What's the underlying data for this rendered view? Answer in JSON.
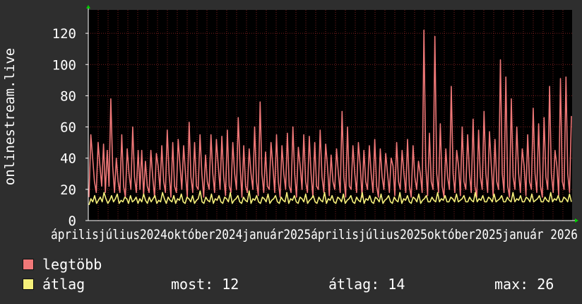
{
  "colors": {
    "background": "#2e2e2e",
    "plot_background": "#000000",
    "grid": "#7a1f1f",
    "axis": "#ffffff",
    "series_max": "#f07878",
    "series_avg": "#f5f07a",
    "arrow": "#00cc00"
  },
  "chart_data": {
    "type": "line",
    "ylabel": "onlinestream.live",
    "ylim": [
      0,
      135
    ],
    "y_ticks": [
      0,
      20,
      40,
      60,
      80,
      100,
      120
    ],
    "x_tick_labels": [
      "április",
      "július",
      "2024",
      "október",
      "2024",
      "január",
      "2025",
      "április",
      "2025",
      "július",
      "2025",
      "október",
      "2025",
      "január",
      "2026"
    ],
    "x_axis_text": "áprilisjúlius2024október2024január2025áprilisjúlius2025október2025január 2026",
    "grid": true,
    "series": [
      {
        "name": "legtöbb",
        "color": "#f07878",
        "values": [
          15,
          55,
          40,
          25,
          18,
          50,
          35,
          22,
          49,
          18,
          45,
          22,
          78,
          35,
          18,
          40,
          25,
          18,
          55,
          22,
          15,
          46,
          30,
          20,
          60,
          28,
          18,
          45,
          20,
          45,
          16,
          38,
          22,
          18,
          45,
          28,
          15,
          43,
          35,
          20,
          48,
          25,
          18,
          58,
          30,
          15,
          50,
          22,
          18,
          52,
          35,
          20,
          48,
          30,
          15,
          63,
          28,
          18,
          50,
          22,
          20,
          55,
          30,
          15,
          42,
          25,
          20,
          55,
          30,
          18,
          52,
          35,
          20,
          54,
          28,
          16,
          58,
          22,
          18,
          50,
          30,
          20,
          66,
          35,
          15,
          48,
          22,
          18,
          46,
          30,
          20,
          60,
          25,
          16,
          76,
          30,
          18,
          44,
          22,
          20,
          50,
          35,
          18,
          55,
          25,
          15,
          48,
          30,
          20,
          56,
          22,
          18,
          60,
          30,
          15,
          47,
          35,
          20,
          55,
          25,
          18,
          54,
          30,
          15,
          50,
          22,
          20,
          58,
          28,
          18,
          49,
          35,
          16,
          42,
          25,
          20,
          46,
          30,
          18,
          70,
          28,
          15,
          60,
          22,
          20,
          48,
          30,
          18,
          50,
          35,
          15,
          45,
          25,
          20,
          48,
          30,
          18,
          52,
          22,
          15,
          46,
          28,
          20,
          43,
          30,
          18,
          40,
          35,
          16,
          50,
          25,
          20,
          45,
          30,
          18,
          52,
          22,
          15,
          48,
          28,
          20,
          38,
          30,
          18,
          122,
          35,
          16,
          56,
          25,
          20,
          118,
          30,
          18,
          62,
          22,
          15,
          46,
          28,
          20,
          86,
          30,
          18,
          45,
          35,
          16,
          60,
          25,
          20,
          55,
          30,
          18,
          65,
          22,
          15,
          58,
          28,
          20,
          70,
          30,
          18,
          57,
          35,
          16,
          52,
          25,
          20,
          103,
          30,
          18,
          92,
          22,
          15,
          78,
          28,
          20,
          60,
          30,
          18,
          46,
          35,
          16,
          55,
          25,
          20,
          72,
          30,
          18,
          62,
          22,
          15,
          66,
          28,
          20,
          86,
          30,
          18,
          45,
          35,
          16,
          91,
          25,
          20,
          92,
          30,
          18,
          67
        ]
      },
      {
        "name": "átlag",
        "color": "#f5f07a",
        "values": [
          10,
          14,
          12,
          16,
          11,
          13,
          15,
          12,
          18,
          14,
          11,
          13,
          16,
          12,
          14,
          17,
          11,
          13,
          12,
          15,
          14,
          11,
          16,
          12,
          13,
          15,
          11,
          14,
          12,
          17,
          13,
          11,
          15,
          12,
          14,
          16,
          11,
          13,
          12,
          18,
          14,
          11,
          15,
          13,
          12,
          16,
          11,
          14,
          13,
          17,
          12,
          11,
          15,
          14,
          12,
          16,
          11,
          13,
          14,
          19,
          12,
          11,
          15,
          13,
          12,
          17,
          11,
          14,
          13,
          16,
          12,
          11,
          15,
          14,
          12,
          18,
          11,
          13,
          14,
          16,
          12,
          11,
          15,
          13,
          12,
          19,
          11,
          14,
          13,
          16,
          12,
          11,
          15,
          14,
          12,
          17,
          11,
          13,
          14,
          16,
          12,
          11,
          15,
          13,
          12,
          18,
          11,
          14,
          13,
          16,
          12,
          11,
          15,
          14,
          12,
          17,
          11,
          13,
          14,
          16,
          12,
          11,
          15,
          13,
          12,
          18,
          11,
          14,
          13,
          16,
          12,
          11,
          15,
          14,
          12,
          17,
          11,
          13,
          14,
          16,
          12,
          11,
          15,
          13,
          12,
          18,
          11,
          14,
          13,
          16,
          12,
          11,
          15,
          14,
          12,
          17,
          11,
          13,
          14,
          16,
          12,
          11,
          15,
          13,
          12,
          18,
          11,
          14,
          13,
          16,
          12,
          11,
          15,
          14,
          12,
          17,
          11,
          13,
          14,
          16,
          12,
          12,
          15,
          13,
          12,
          18,
          12,
          14,
          13,
          16,
          12,
          12,
          15,
          14,
          12,
          17,
          12,
          13,
          14,
          16,
          12,
          12,
          15,
          13,
          12,
          18,
          12,
          14,
          13,
          16,
          12,
          12,
          15,
          14,
          12,
          17,
          12,
          13,
          14,
          16,
          12,
          12,
          15,
          13,
          12,
          18,
          12,
          14,
          13,
          16,
          12,
          12,
          15,
          14,
          12,
          17,
          12,
          13,
          14,
          16,
          12,
          12,
          15,
          13,
          12,
          18,
          12,
          14,
          13,
          16,
          12,
          12,
          15,
          14,
          12,
          17,
          12
        ]
      }
    ]
  },
  "legend": {
    "max_label": "legtöbb",
    "avg_label": "átlag"
  },
  "stats": {
    "now": "most: 12",
    "avg": "átlag: 14",
    "max": "max: 26"
  }
}
